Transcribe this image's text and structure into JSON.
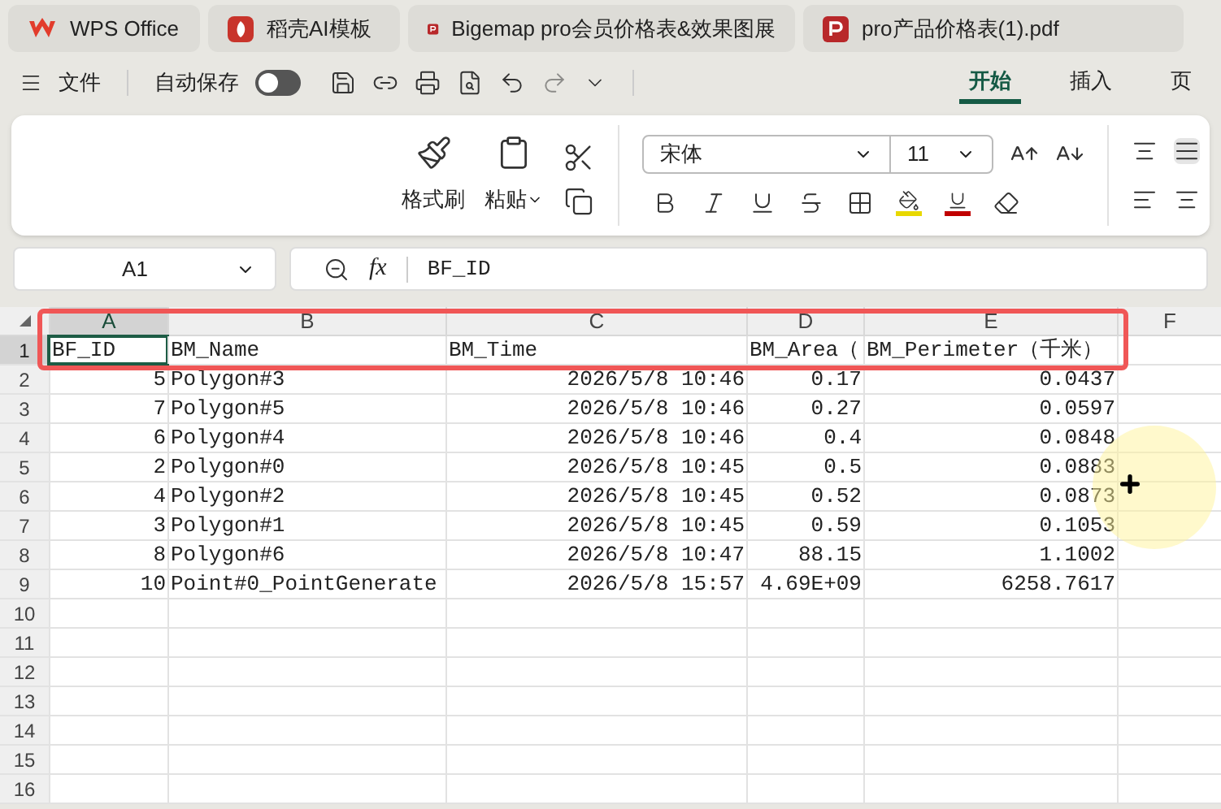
{
  "tabs": [
    {
      "label": "WPS Office",
      "kind": "wps"
    },
    {
      "label": "稻壳AI模板",
      "kind": "docer"
    },
    {
      "label": "Bigemap pro会员价格表&效果图展",
      "kind": "pdf"
    },
    {
      "label": "pro产品价格表(1).pdf",
      "kind": "pdf"
    }
  ],
  "quick_toolbar": {
    "menu_label": "文件",
    "autosave": {
      "label": "自动保存",
      "on": false
    }
  },
  "ribbon_tabs": [
    {
      "label": "开始",
      "selected": true
    },
    {
      "label": "插入",
      "selected": false
    },
    {
      "label": "页",
      "selected": false
    }
  ],
  "ribbon": {
    "format_painter": "格式刷",
    "paste": "粘贴",
    "font": "宋体",
    "font_size": "11"
  },
  "formula_bar": {
    "cell": "A1",
    "function_label": "fx",
    "value": "BF_ID"
  },
  "sheet": {
    "columns": [
      {
        "label": "A",
        "selected": true
      },
      {
        "label": "B",
        "selected": false
      },
      {
        "label": "C",
        "selected": false
      },
      {
        "label": "D",
        "selected": false
      },
      {
        "label": "E",
        "selected": false
      },
      {
        "label": "F",
        "selected": false
      }
    ],
    "rows": [
      {
        "label": "1",
        "selected": true,
        "kind": "header",
        "cells": [
          "BF_ID",
          "BM_Name",
          "BM_Time",
          "BM_Area（",
          "BM_Perimeter（千米）"
        ]
      },
      {
        "label": "2",
        "selected": false,
        "kind": "data",
        "cells": [
          "5",
          "Polygon#3",
          "2026/5/8 10:46",
          "0.17",
          "0.0437"
        ]
      },
      {
        "label": "3",
        "selected": false,
        "kind": "data",
        "cells": [
          "7",
          "Polygon#5",
          "2026/5/8 10:46",
          "0.27",
          "0.0597"
        ]
      },
      {
        "label": "4",
        "selected": false,
        "kind": "data",
        "cells": [
          "6",
          "Polygon#4",
          "2026/5/8 10:46",
          "0.4",
          "0.0848"
        ]
      },
      {
        "label": "5",
        "selected": false,
        "kind": "data",
        "cells": [
          "2",
          "Polygon#0",
          "2026/5/8 10:45",
          "0.5",
          "0.0883"
        ]
      },
      {
        "label": "6",
        "selected": false,
        "kind": "data",
        "cells": [
          "4",
          "Polygon#2",
          "2026/5/8 10:45",
          "0.52",
          "0.0873"
        ]
      },
      {
        "label": "7",
        "selected": false,
        "kind": "data",
        "cells": [
          "3",
          "Polygon#1",
          "2026/5/8 10:45",
          "0.59",
          "0.1053"
        ]
      },
      {
        "label": "8",
        "selected": false,
        "kind": "data",
        "cells": [
          "8",
          "Polygon#6",
          "2026/5/8 10:47",
          "88.15",
          "1.1002"
        ]
      },
      {
        "label": "9",
        "selected": false,
        "kind": "data",
        "cells": [
          "10",
          "Point#0_PointGenerate",
          "2026/5/8 15:57",
          "4.69E+09",
          "6258.7617"
        ]
      },
      {
        "label": "10",
        "selected": false,
        "kind": "data",
        "cells": []
      },
      {
        "label": "11",
        "selected": false,
        "kind": "data",
        "cells": []
      },
      {
        "label": "12",
        "selected": false,
        "kind": "data",
        "cells": []
      },
      {
        "label": "13",
        "selected": false,
        "kind": "data",
        "cells": []
      },
      {
        "label": "14",
        "selected": false,
        "kind": "data",
        "cells": []
      },
      {
        "label": "15",
        "selected": false,
        "kind": "data",
        "cells": []
      },
      {
        "label": "16",
        "selected": false,
        "kind": "data",
        "cells": []
      }
    ]
  }
}
